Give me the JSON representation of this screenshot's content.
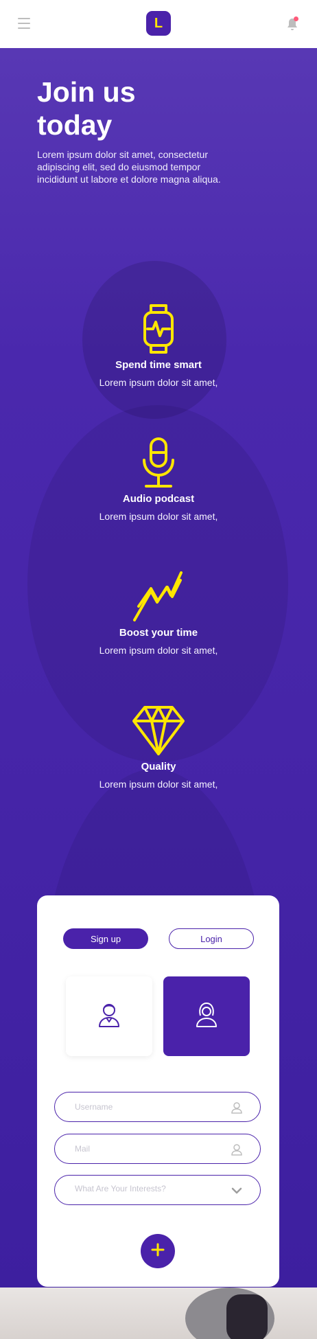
{
  "header": {
    "logo_letter": "L",
    "icons": {
      "menu": "menu-icon",
      "bell": "bell-icon"
    },
    "colors": {
      "logo_bg": "#4a22aa",
      "logo_text": "#ffe600",
      "badge": "#ff5b7a"
    }
  },
  "hero": {
    "title": "Join us today",
    "intro": "Lorem ipsum dolor sit amet, consectetur adipiscing elit, sed do eiusmod tempor incididunt ut labore et dolore magna aliqua.",
    "colors": {
      "accent": "#ffe600",
      "primary": "#4a22aa"
    }
  },
  "features": [
    {
      "icon": "smartwatch-icon",
      "title": "Spend time smart",
      "text": "Lorem ipsum dolor sit amet,"
    },
    {
      "icon": "microphone-icon",
      "title": "Audio podcast",
      "text": "Lorem ipsum dolor sit amet,"
    },
    {
      "icon": "zigzag-icon",
      "title": "Boost your time",
      "text": "Lorem ipsum dolor sit amet,"
    },
    {
      "icon": "diamond-icon",
      "title": "Quality",
      "text": "Lorem ipsum dolor sit amet,"
    }
  ],
  "form": {
    "tabs": {
      "signup": "Sign up",
      "login": "Login"
    },
    "genders": [
      {
        "icon": "male-avatar-icon"
      },
      {
        "icon": "female-avatar-icon"
      }
    ],
    "username_placeholder": "Username",
    "mail_placeholder": "Mail",
    "interests_placeholder": "What Are Your Interests?",
    "submit_icon": "plus-icon"
  }
}
